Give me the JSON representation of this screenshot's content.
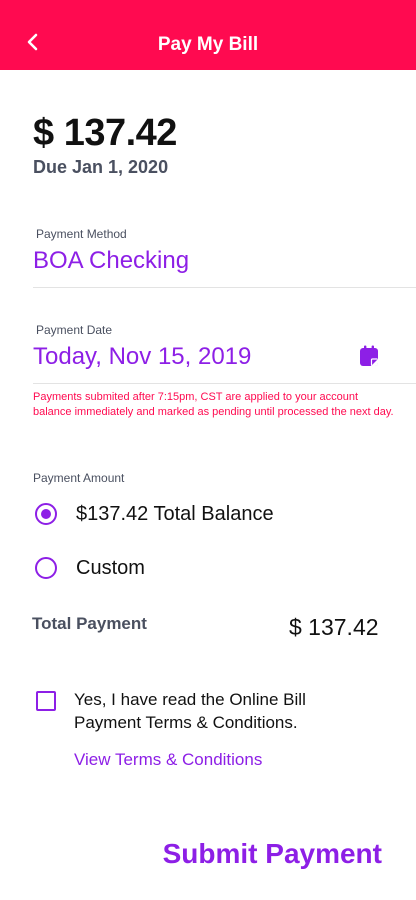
{
  "header": {
    "title": "Pay My Bill",
    "color": "#ff0a50"
  },
  "bill": {
    "amount": "$ 137.42",
    "due": "Due Jan 1, 2020"
  },
  "payment_method": {
    "label": "Payment Method",
    "value": "BOA Checking"
  },
  "payment_date": {
    "label": "Payment Date",
    "value": "Today, Nov 15, 2019",
    "icon": "calendar-icon"
  },
  "warning": "Payments submited after 7:15pm, CST are applied to your account balance immediately and marked as pending until processed the next day.",
  "payment_amount": {
    "label": "Payment Amount",
    "options": [
      {
        "label": "$137.42 Total Balance",
        "selected": true
      },
      {
        "label": "Custom",
        "selected": false
      }
    ]
  },
  "total": {
    "label": "Total Payment",
    "value": "$ 137.42"
  },
  "terms": {
    "checked": false,
    "text": "Yes, I have read the Online Bill Payment Terms & Conditions.",
    "link": "View Terms & Conditions"
  },
  "submit_label": "Submit Payment",
  "accent_color": "#8d1fe6"
}
